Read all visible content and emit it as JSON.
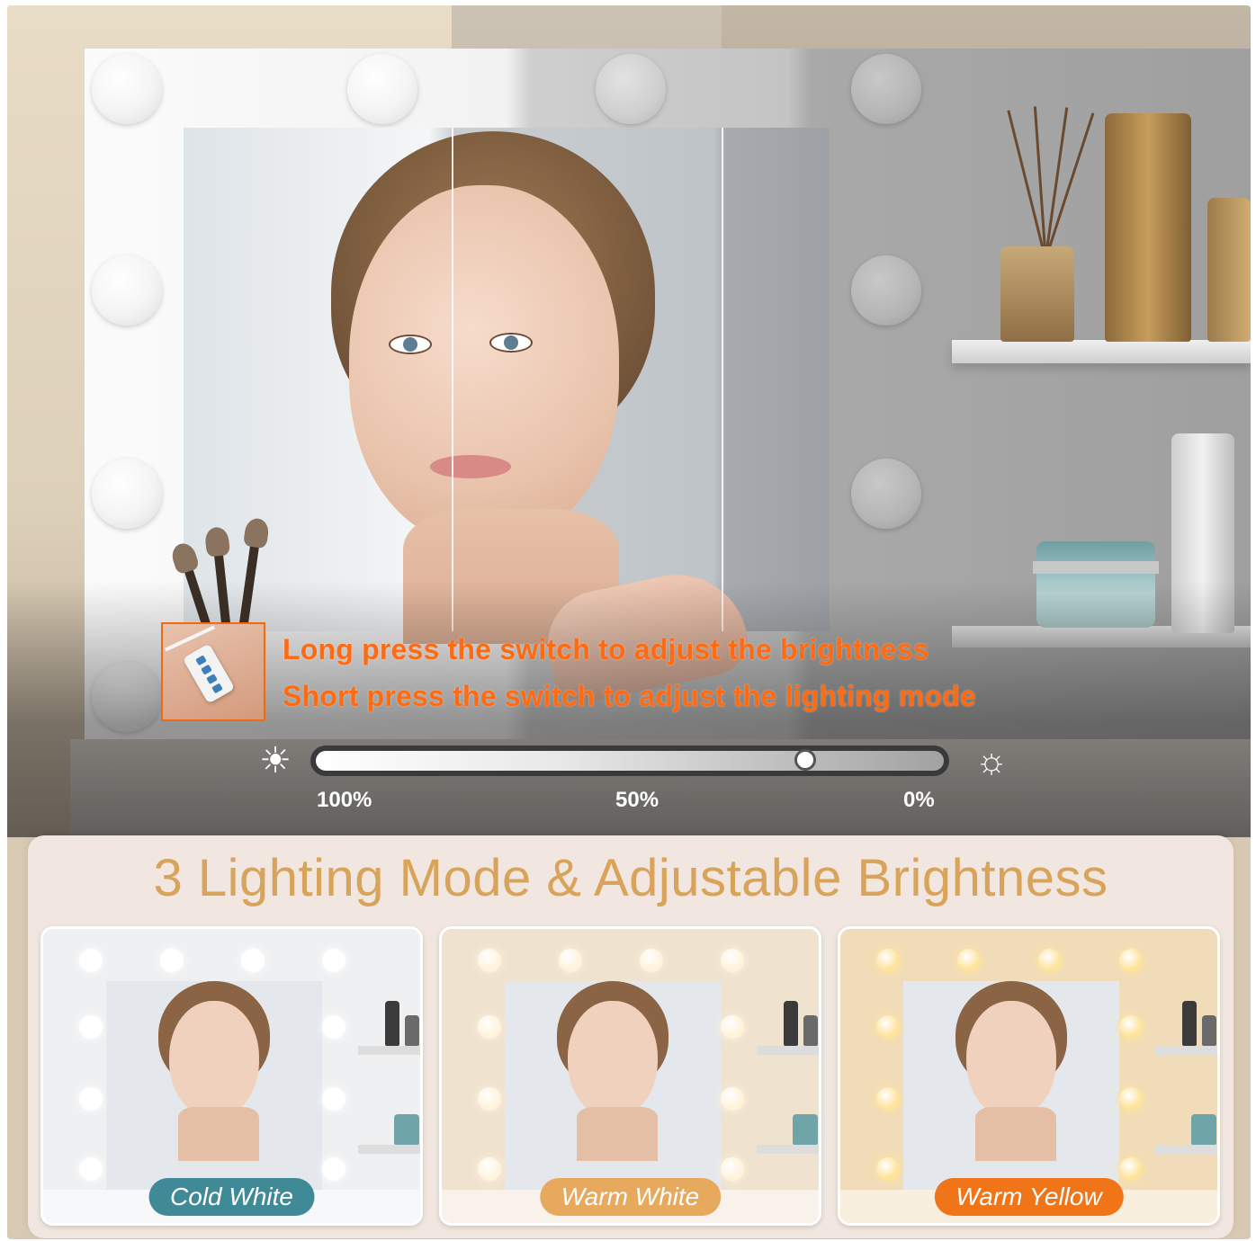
{
  "instructions": {
    "line1": "Long press the switch to adjust the brightness",
    "line2": "Short press the switch to adjust the lighting mode"
  },
  "brightness": {
    "labels": {
      "high": "100%",
      "mid": "50%",
      "low": "0%"
    },
    "level_percent": 22,
    "icons": {
      "left": "sun-bright-icon",
      "right": "sun-dim-icon"
    }
  },
  "headline": "3 Lighting Mode & Adjustable Brightness",
  "modes": [
    {
      "label": "Cold White",
      "badge_color": "#3f8a96",
      "bulb_color": "#ffffff",
      "tint": "#eef0f2"
    },
    {
      "label": "Warm White",
      "badge_color": "#e7a95e",
      "bulb_color": "#fff3dc",
      "tint": "#efe3d0"
    },
    {
      "label": "Warm Yellow",
      "badge_color": "#f07418",
      "bulb_color": "#ffe39b",
      "tint": "#f1dcb9"
    }
  ],
  "colors": {
    "accent_orange": "#ff6b12",
    "headline_gold": "#d8a35a"
  }
}
